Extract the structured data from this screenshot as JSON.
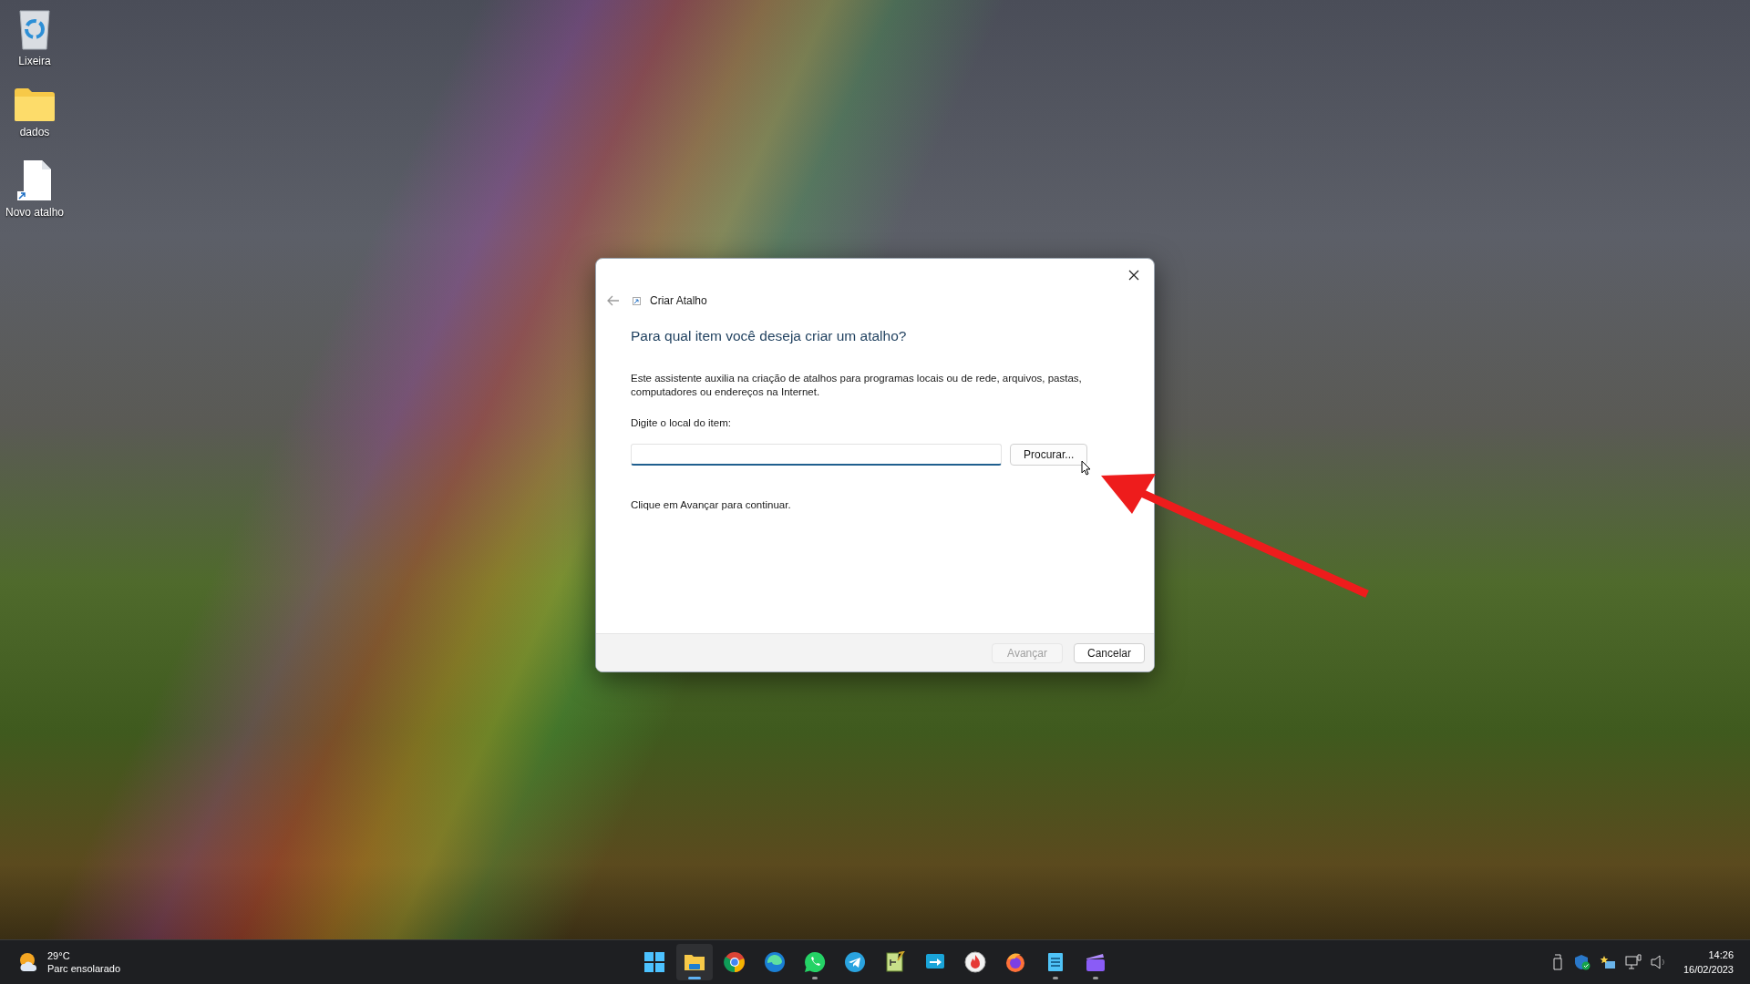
{
  "desktop_icons": [
    {
      "label": "Lixeira",
      "kind": "recycle"
    },
    {
      "label": "dados",
      "kind": "folder"
    },
    {
      "label": "Novo atalho",
      "kind": "shortcut"
    }
  ],
  "dialog": {
    "title": "Criar Atalho",
    "heading": "Para qual item você deseja criar um atalho?",
    "description": "Este assistente auxilia na criação de atalhos para programas locais ou de rede, arquivos, pastas, computadores ou endereços na Internet.",
    "field_label": "Digite o local do item:",
    "browse_button": "Procurar...",
    "hint": "Clique em Avançar para continuar.",
    "buttons": [
      {
        "label": "Avançar",
        "disabled": true
      },
      {
        "label": "Cancelar",
        "disabled": false
      }
    ]
  },
  "taskbar": {
    "weather": {
      "temperature": "29°C",
      "condition": "Parc ensolarado"
    },
    "apps": [
      {
        "kind": "start",
        "running": false,
        "selected": false
      },
      {
        "kind": "folder",
        "running": true,
        "selected": true
      },
      {
        "kind": "globe",
        "running": false,
        "selected": false
      },
      {
        "kind": "wave",
        "running": false,
        "selected": false
      },
      {
        "kind": "phone",
        "running": true,
        "selected": false
      },
      {
        "kind": "plane",
        "running": false,
        "selected": false
      },
      {
        "kind": "editor",
        "running": false,
        "selected": false
      },
      {
        "kind": "remote",
        "running": false,
        "selected": false
      },
      {
        "kind": "flame",
        "running": false,
        "selected": false
      },
      {
        "kind": "fox",
        "running": false,
        "selected": false
      },
      {
        "kind": "notes",
        "running": true,
        "selected": false
      },
      {
        "kind": "clapper",
        "running": true,
        "selected": false
      }
    ],
    "clock": {
      "time": "14:26",
      "date": "16/02/2023"
    }
  }
}
